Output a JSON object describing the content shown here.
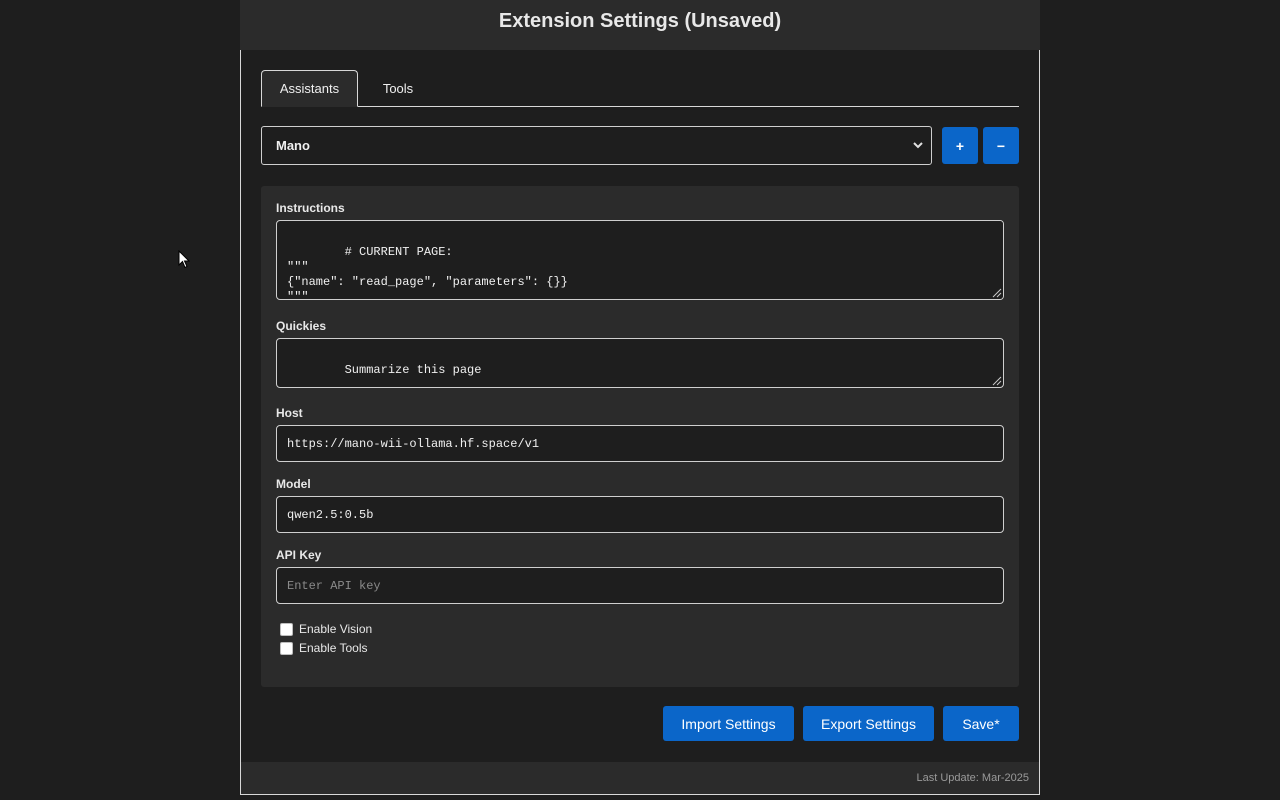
{
  "header": {
    "title": "Extension Settings (Unsaved)"
  },
  "tabs": [
    {
      "label": "Assistants",
      "active": true
    },
    {
      "label": "Tools",
      "active": false
    }
  ],
  "assistant_select": {
    "selected": "Mano",
    "add_label": "+",
    "remove_label": "−"
  },
  "form": {
    "instructions": {
      "label": "Instructions",
      "value": "# CURRENT PAGE:\n\"\"\"\n{\"name\": \"read_page\", \"parameters\": {}}\n\"\"\"\nYou are Mano"
    },
    "quickies": {
      "label": "Quickies",
      "value": "Summarize this page"
    },
    "host": {
      "label": "Host",
      "value": "https://mano-wii-ollama.hf.space/v1"
    },
    "model": {
      "label": "Model",
      "value": "qwen2.5:0.5b"
    },
    "api_key": {
      "label": "API Key",
      "value": "",
      "placeholder": "Enter API key"
    },
    "enable_vision": {
      "label": "Enable Vision",
      "checked": false
    },
    "enable_tools": {
      "label": "Enable Tools",
      "checked": false
    }
  },
  "actions": {
    "import_label": "Import Settings",
    "export_label": "Export Settings",
    "save_label": "Save*"
  },
  "footer": {
    "last_update": "Last Update: Mar-2025"
  },
  "colors": {
    "background": "#1e1e1e",
    "card": "#2b2b2b",
    "accent": "#0b66c9"
  }
}
